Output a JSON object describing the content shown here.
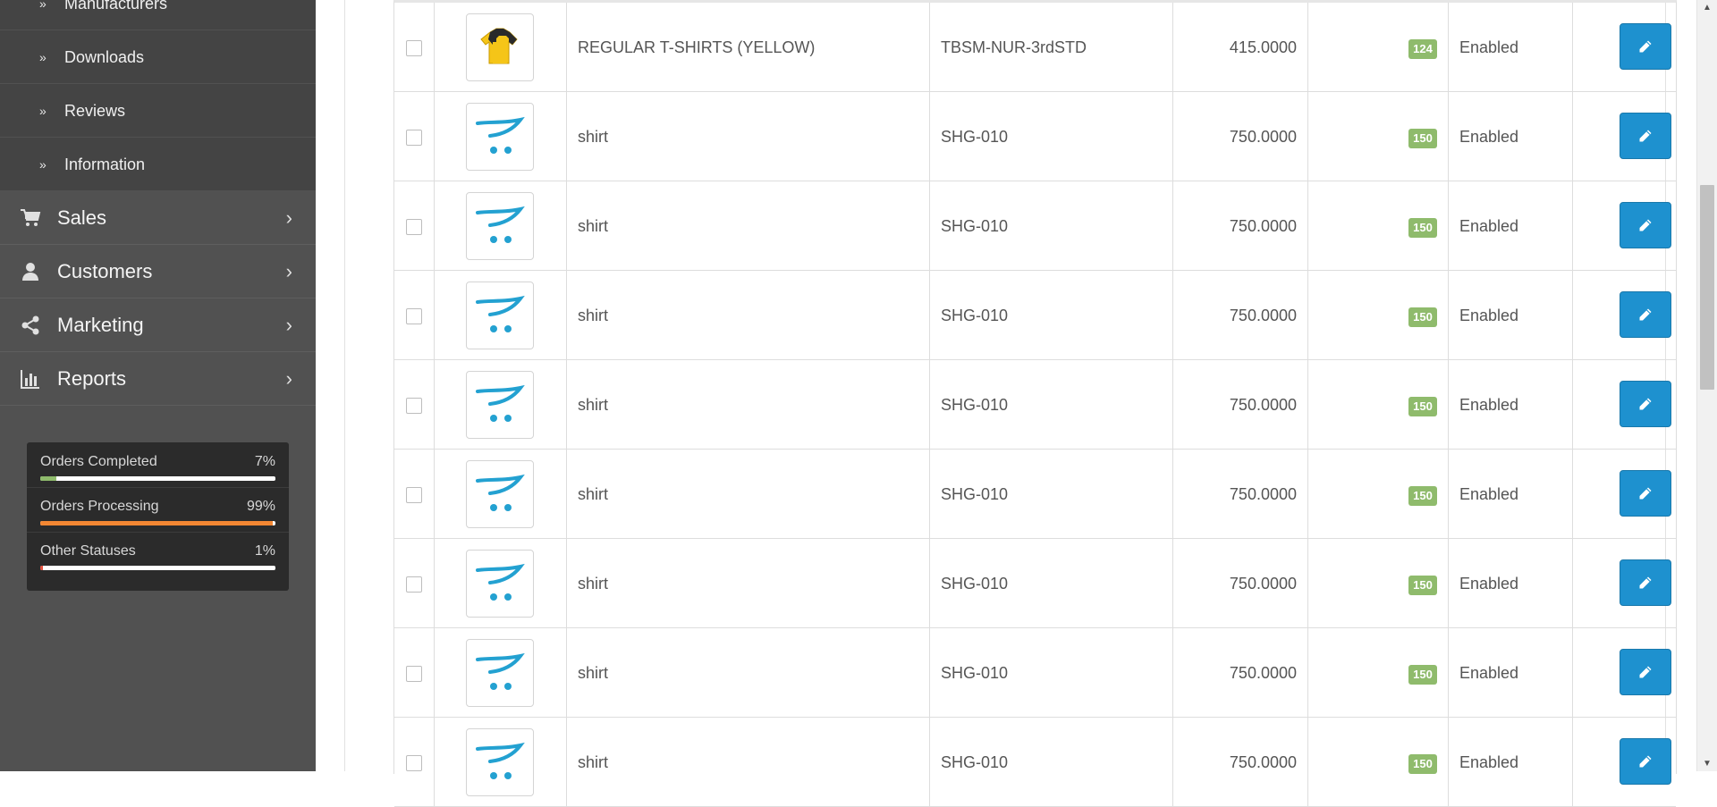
{
  "sidebar": {
    "catalog_subitems": [
      {
        "label": "Manufacturers"
      },
      {
        "label": "Downloads"
      },
      {
        "label": "Reviews"
      },
      {
        "label": "Information"
      }
    ],
    "menu": [
      {
        "label": "Sales",
        "icon": "shopping-cart-icon"
      },
      {
        "label": "Customers",
        "icon": "user-icon"
      },
      {
        "label": "Marketing",
        "icon": "share-icon"
      },
      {
        "label": "Reports",
        "icon": "bar-chart-icon"
      }
    ],
    "stats": [
      {
        "label": "Orders Completed",
        "value": "7%",
        "percent": 7,
        "color": "#8fbb6c"
      },
      {
        "label": "Orders Processing",
        "value": "99%",
        "percent": 99,
        "color": "#f38733"
      },
      {
        "label": "Other Statuses",
        "value": "1%",
        "percent": 1,
        "color": "#e3503e"
      }
    ]
  },
  "products": {
    "rows": [
      {
        "image": "yellow-tshirt",
        "name": "REGULAR T-SHIRTS (YELLOW)",
        "model": "TBSM-NUR-3rdSTD",
        "price": "415.0000",
        "quantity": "124",
        "status": "Enabled"
      },
      {
        "image": "opencart-placeholder",
        "name": "shirt",
        "model": "SHG-010",
        "price": "750.0000",
        "quantity": "150",
        "status": "Enabled"
      },
      {
        "image": "opencart-placeholder",
        "name": "shirt",
        "model": "SHG-010",
        "price": "750.0000",
        "quantity": "150",
        "status": "Enabled"
      },
      {
        "image": "opencart-placeholder",
        "name": "shirt",
        "model": "SHG-010",
        "price": "750.0000",
        "quantity": "150",
        "status": "Enabled"
      },
      {
        "image": "opencart-placeholder",
        "name": "shirt",
        "model": "SHG-010",
        "price": "750.0000",
        "quantity": "150",
        "status": "Enabled"
      },
      {
        "image": "opencart-placeholder",
        "name": "shirt",
        "model": "SHG-010",
        "price": "750.0000",
        "quantity": "150",
        "status": "Enabled"
      },
      {
        "image": "opencart-placeholder",
        "name": "shirt",
        "model": "SHG-010",
        "price": "750.0000",
        "quantity": "150",
        "status": "Enabled"
      },
      {
        "image": "opencart-placeholder",
        "name": "shirt",
        "model": "SHG-010",
        "price": "750.0000",
        "quantity": "150",
        "status": "Enabled"
      },
      {
        "image": "opencart-placeholder",
        "name": "shirt",
        "model": "SHG-010",
        "price": "750.0000",
        "quantity": "150",
        "status": "Enabled"
      }
    ],
    "edit_icon": "pencil-icon",
    "quantity_badge_color": "#8fbb6c",
    "edit_button_color": "#1e91cf"
  },
  "theme": {
    "sidebar_bg": "#515151",
    "subitem_bg": "#444444",
    "stats_bg": "#2b2b2b"
  }
}
